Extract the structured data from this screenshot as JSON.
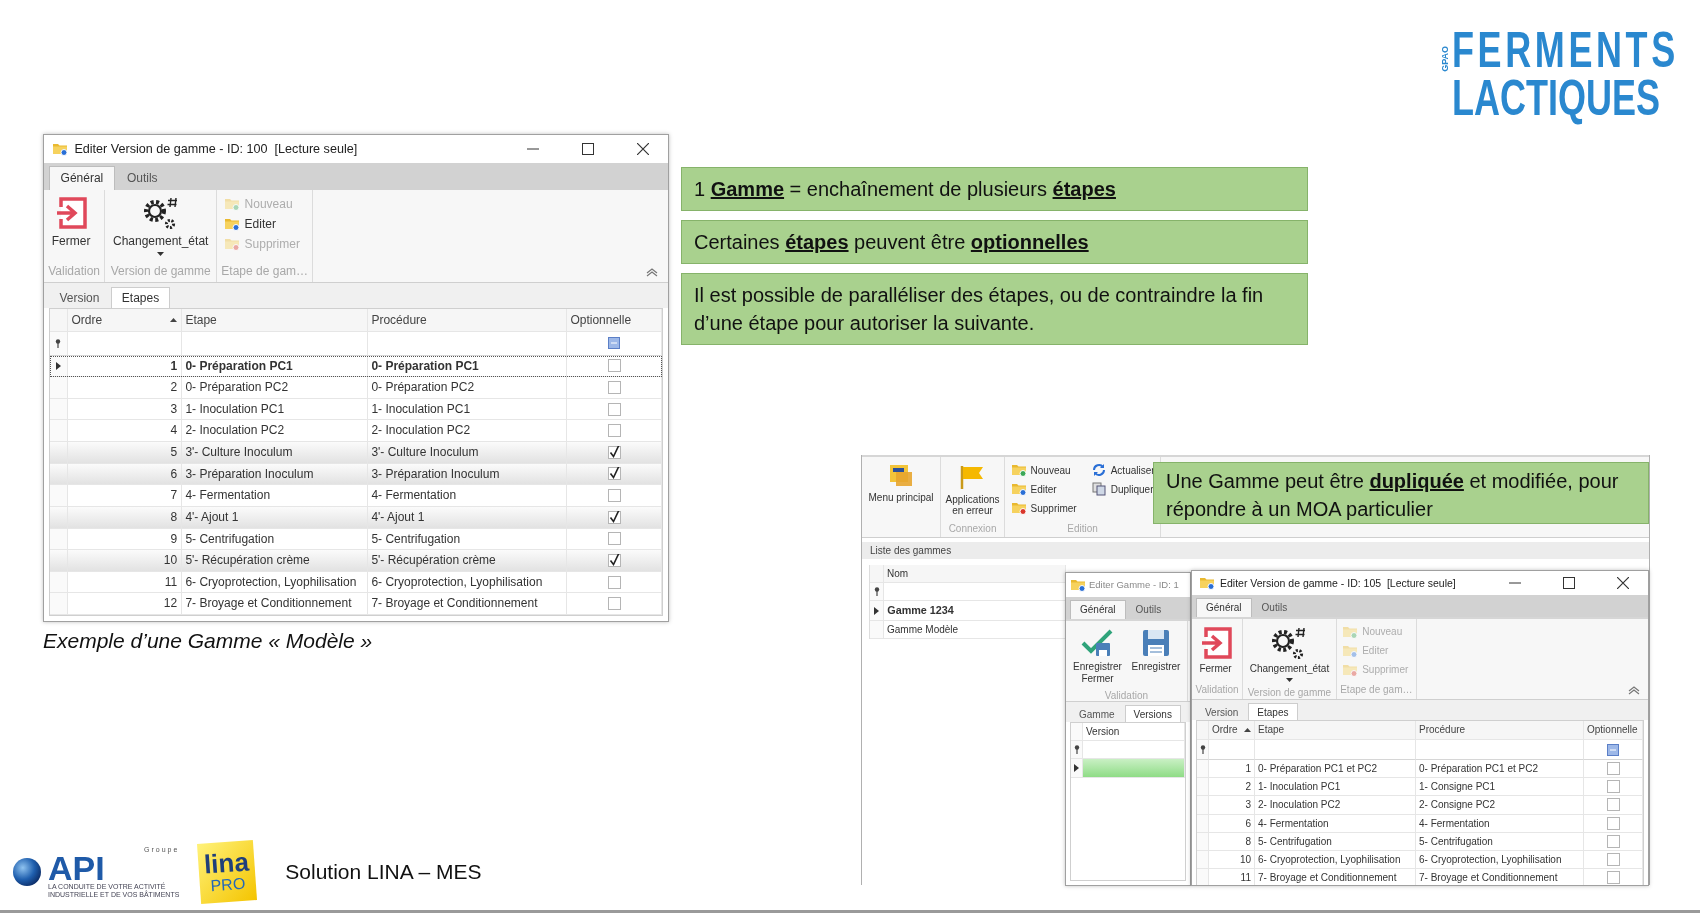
{
  "brand_logo": {
    "side_text": "GPAO",
    "line_1": "FERMENTS",
    "line_2": "LACTIQUES"
  },
  "model_window": {
    "title": "Editer Version de gamme - ID: 100  [Lecture seule]",
    "tabs": [
      {
        "label": "Général",
        "selected": true
      },
      {
        "label": "Outils",
        "selected": false
      }
    ],
    "ribbon": [
      {
        "label": "Validation",
        "items": [
          {
            "kind": "close",
            "label": "Fermer",
            "disabled": false
          }
        ]
      },
      {
        "label": "Version de gamme",
        "items": [
          {
            "kind": "state",
            "label": "Changement_état",
            "disabled": false
          }
        ]
      },
      {
        "label": "Etape de gam…",
        "items": [
          {
            "kind": "new",
            "label": "Nouveau",
            "disabled": true
          },
          {
            "kind": "edit",
            "label": "Editer",
            "disabled": false
          },
          {
            "kind": "delete",
            "label": "Supprimer",
            "disabled": true
          }
        ]
      }
    ],
    "subtabs": [
      {
        "label": "Version",
        "selected": false
      },
      {
        "label": "Etapes",
        "selected": true
      }
    ],
    "columns": [
      "Ordre",
      "Etape",
      "Procédure",
      "Optionnelle"
    ],
    "rows": [
      {
        "ordre": "1",
        "etape": "0- Préparation PC1",
        "procedure": "0- Préparation PC1",
        "optionnelle": false,
        "current": true
      },
      {
        "ordre": "2",
        "etape": "0- Préparation PC2",
        "procedure": "0- Préparation PC2",
        "optionnelle": false,
        "current": false
      },
      {
        "ordre": "3",
        "etape": "1- Inoculation PC1",
        "procedure": "1- Inoculation PC1",
        "optionnelle": false,
        "current": false
      },
      {
        "ordre": "4",
        "etape": "2- Inoculation PC2",
        "procedure": "2- Inoculation PC2",
        "optionnelle": false,
        "current": false
      },
      {
        "ordre": "5",
        "etape": "3'- Culture Inoculum",
        "procedure": "3'- Culture Inoculum",
        "optionnelle": true,
        "current": false
      },
      {
        "ordre": "6",
        "etape": "3- Préparation Inoculum",
        "procedure": "3- Préparation Inoculum",
        "optionnelle": true,
        "current": false
      },
      {
        "ordre": "7",
        "etape": "4- Fermentation",
        "procedure": "4- Fermentation",
        "optionnelle": false,
        "current": false
      },
      {
        "ordre": "8",
        "etape": "4'- Ajout 1",
        "procedure": "4'- Ajout 1",
        "optionnelle": true,
        "current": false
      },
      {
        "ordre": "9",
        "etape": "5- Centrifugation",
        "procedure": "5- Centrifugation",
        "optionnelle": false,
        "current": false
      },
      {
        "ordre": "10",
        "etape": "5'- Récupération crème",
        "procedure": "5'- Récupération crème",
        "optionnelle": true,
        "current": false
      },
      {
        "ordre": "11",
        "etape": "6- Cryoprotection, Lyophilisation",
        "procedure": "6- Cryoprotection, Lyophilisation",
        "optionnelle": false,
        "current": false
      },
      {
        "ordre": "12",
        "etape": "7- Broyage et Conditionnement",
        "procedure": "7- Broyage et Conditionnement",
        "optionnelle": false,
        "current": false
      }
    ]
  },
  "caption": "Exemple d’une Gamme « Modèle »",
  "callouts": [
    "1 **Gamme** = enchaînement de plusieurs **étapes**",
    "Certaines **étapes** peuvent être **optionnelles**",
    "Il est possible de paralléliser des étapes, ou de contraindre la fin d’une étape pour autoriser la suivante."
  ],
  "composite": {
    "ribbon": [
      {
        "items": [
          {
            "kind": "menu",
            "label": "Menu principal",
            "disabled": false
          }
        ]
      },
      {
        "label": "Connexion",
        "items": [
          {
            "kind": "alerts",
            "label": "Applications en erreur",
            "disabled": false
          }
        ]
      },
      {
        "label": "Edition",
        "items": [
          {
            "kind": "new",
            "label": "Nouveau",
            "disabled": false
          },
          {
            "kind": "edit",
            "label": "Editer",
            "disabled": false
          },
          {
            "kind": "delete",
            "label": "Supprimer",
            "disabled": false
          },
          {
            "kind": "refresh",
            "label": "Actualiser",
            "disabled": false
          },
          {
            "kind": "duplicate",
            "label": "Dupliquer",
            "disabled": false
          }
        ]
      }
    ],
    "callout": "Une Gamme peut être **dupliquée** et modifiée, pour répondre à un MOA particulier",
    "list_title": "Liste des gammes",
    "list_column": "Nom",
    "list_rows": [
      {
        "label": "Gamme 1234",
        "current": true
      },
      {
        "label": "Gamme Modèle",
        "current": false
      }
    ],
    "gamme_window": {
      "title": "Editer Gamme - ID: 1",
      "tabs": [
        {
          "label": "Général",
          "selected": true
        },
        {
          "label": "Outils",
          "selected": false
        }
      ],
      "ribbon": [
        {
          "label": "Validation",
          "items": [
            {
              "kind": "save-close",
              "label": "Enregistrer Fermer",
              "disabled": false
            },
            {
              "kind": "save",
              "label": "Enregistrer",
              "disabled": false
            }
          ]
        }
      ],
      "subtabs": [
        {
          "label": "Gamme",
          "selected": false
        },
        {
          "label": "Versions",
          "selected": true
        }
      ],
      "column": "Version",
      "rows": [
        {
          "selected": true
        }
      ]
    },
    "version_window": {
      "title": "Editer Version de gamme - ID: 105  [Lecture seule]",
      "tabs": [
        {
          "label": "Général",
          "selected": true
        },
        {
          "label": "Outils",
          "selected": false
        }
      ],
      "ribbon": [
        {
          "label": "Validation",
          "items": [
            {
              "kind": "close",
              "label": "Fermer",
              "disabled": false
            }
          ]
        },
        {
          "label": "Version de gamme",
          "items": [
            {
              "kind": "state",
              "label": "Changement_état",
              "disabled": false
            }
          ]
        },
        {
          "label": "Etape de gam…",
          "items": [
            {
              "kind": "new",
              "label": "Nouveau",
              "disabled": true
            },
            {
              "kind": "edit",
              "label": "Editer",
              "disabled": true
            },
            {
              "kind": "delete",
              "label": "Supprimer",
              "disabled": true
            }
          ]
        }
      ],
      "subtabs": [
        {
          "label": "Version",
          "selected": false
        },
        {
          "label": "Etapes",
          "selected": true
        }
      ],
      "columns": [
        "Ordre",
        "Etape",
        "Procédure",
        "Optionnelle"
      ],
      "rows": [
        {
          "ordre": "1",
          "etape": "0- Préparation PC1 et PC2",
          "procedure": "0- Préparation PC1 et PC2",
          "optionnelle": false,
          "current": false
        },
        {
          "ordre": "2",
          "etape": "1- Inoculation PC1",
          "procedure": "1- Consigne PC1",
          "optionnelle": false,
          "current": false
        },
        {
          "ordre": "3",
          "etape": "2- Inoculation PC2",
          "procedure": "2- Consigne PC2",
          "optionnelle": false,
          "current": false
        },
        {
          "ordre": "6",
          "etape": "4- Fermentation",
          "procedure": "4- Fermentation",
          "optionnelle": false,
          "current": false
        },
        {
          "ordre": "8",
          "etape": "5- Centrifugation",
          "procedure": "5- Centrifugation",
          "optionnelle": false,
          "current": false
        },
        {
          "ordre": "10",
          "etape": "6- Cryoprotection, Lyophilisation",
          "procedure": "6- Cryoprotection, Lyophilisation",
          "optionnelle": false,
          "current": false
        },
        {
          "ordre": "11",
          "etape": "7- Broyage et Conditionnement",
          "procedure": "7- Broyage et Conditionnement",
          "optionnelle": false,
          "current": false
        }
      ]
    }
  },
  "footer": {
    "group_label": "Groupe",
    "api_name": "API",
    "api_tagline_1": "LA CONDUITE DE VOTRE ACTIVITÉ",
    "api_tagline_2": "INDUSTRIELLE ET DE VOS BÂTIMENTS",
    "lina_name": "lina",
    "lina_edition": "PRO",
    "title": "Solution LINA – MES"
  }
}
